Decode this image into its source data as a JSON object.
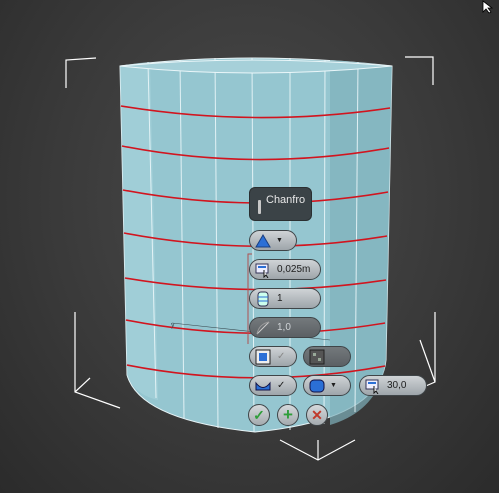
{
  "caddy": {
    "title": "Chanfro",
    "amount": "0,025m",
    "segments": "1",
    "tension": "1,0",
    "angle": "30,0"
  },
  "colors": {
    "cylinder": "#92c4cf",
    "edge_loops": "#d2141e",
    "bounding_box": "#ffffff",
    "accept": "#2f9e3a",
    "apply": "#2f9e3a",
    "cancel": "#c0392b"
  },
  "icons": {
    "accept": "check-icon",
    "apply": "plus-icon",
    "cancel": "x-icon"
  }
}
